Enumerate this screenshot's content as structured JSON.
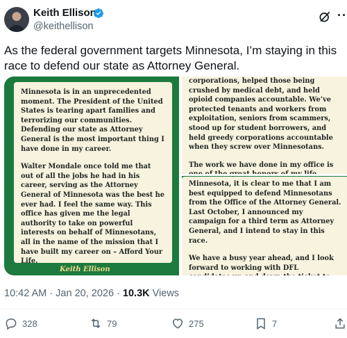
{
  "author": {
    "name": "Keith Ellison",
    "handle": "@keithellison"
  },
  "tweet": {
    "text": "As the federal government targets Minnesota, I’m staying in this race to defend our state as Attorney General."
  },
  "media": {
    "left_card": {
      "para1": "Minnesota is in an unprecedented moment. The President of the United States is tearing apart families and terrorizing our communities. Defending our state as Attorney General is the most important thing I have done in my career.",
      "para2": "Walter Mondale once told me that out of all the jobs he had in his career, serving as the Attorney General of Minnesota was the best he ever had. I feel the same way. This office has given me the legal authority to take on powerful interests on behalf of Minnesotans, all in the name of the mission that I have built my career on – Afford Your Life.",
      "signature": "Keith Ellison"
    },
    "right_top_card": {
      "para1": "corporations, helped those being crushed by medical debt, and held opioid companies accountable. We’ve protected tenants and workers from exploitation, seniors from scammers, stood up for student borrowers, and held greedy corporations accountable when they screw over Minnesotans.",
      "para2": "The work we have done in my office is one of the great honors of my life."
    },
    "right_bottom_card": {
      "para1": "Minnesota, it is clear to me that I am best equipped to defend Minnesotans from the Office of the Attorney General. Last October, I announced my campaign for a third term as Attorney General, and I intend to stay in this race.",
      "para2": "We have a busy year ahead, and I look forward to working with DFL candidates up and down the ticket to"
    }
  },
  "meta": {
    "time": "10:42 AM",
    "separator": " · ",
    "date": "Jan 20, 2026",
    "views_count": "10.3K",
    "views_label": " Views"
  },
  "actions": {
    "replies": "328",
    "reposts": "79",
    "likes": "275",
    "bookmarks": "7"
  },
  "colors": {
    "verified": "#1d9bf0",
    "media_green": "#1d7a3e",
    "card_bg": "#f8f3df"
  }
}
